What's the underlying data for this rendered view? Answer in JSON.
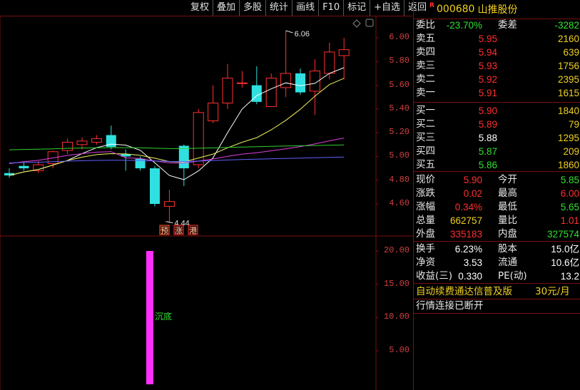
{
  "toolbar": {
    "items": [
      "复权",
      "叠加",
      "多股",
      "统计",
      "画线",
      "F10",
      "标记",
      "+自选",
      "返回"
    ]
  },
  "stock": {
    "badge": "R",
    "code": "000680",
    "name": "山推股份"
  },
  "price_axis": [
    "6.00",
    "5.80",
    "5.60",
    "5.40",
    "5.20",
    "5.00",
    "4.80",
    "4.60"
  ],
  "indicator_axis": [
    "20.00",
    "15.00",
    "10.00",
    "5.00"
  ],
  "annotations": {
    "high_mark": "6.06",
    "low_mark": "4.44",
    "tags": [
      "预",
      "涨",
      "港"
    ],
    "indicator_label": "沉底"
  },
  "colors": {
    "up": "#ff3030",
    "down": "#30e0e0",
    "ma5": "#ffffff",
    "ma10": "#f0f060",
    "ma20": "#e040e0",
    "ma30": "#30d030",
    "ma60": "#6060ff",
    "indicator_bar": "#ff30ff"
  },
  "chart_data": {
    "type": "candlestick",
    "y_range": [
      4.4,
      6.1
    ],
    "candles": [
      {
        "o": 4.86,
        "h": 4.9,
        "l": 4.82,
        "c": 4.84,
        "up": false
      },
      {
        "o": 4.92,
        "h": 4.95,
        "l": 4.88,
        "c": 4.9,
        "up": false
      },
      {
        "o": 4.88,
        "h": 4.96,
        "l": 4.86,
        "c": 4.93,
        "up": true
      },
      {
        "o": 4.94,
        "h": 5.05,
        "l": 4.9,
        "c": 5.04,
        "up": true
      },
      {
        "o": 5.05,
        "h": 5.15,
        "l": 5.02,
        "c": 5.12,
        "up": true
      },
      {
        "o": 5.1,
        "h": 5.16,
        "l": 5.06,
        "c": 5.13,
        "up": true
      },
      {
        "o": 5.12,
        "h": 5.18,
        "l": 5.1,
        "c": 5.15,
        "up": true
      },
      {
        "o": 5.18,
        "h": 5.26,
        "l": 5.06,
        "c": 5.08,
        "up": false
      },
      {
        "o": 5.02,
        "h": 5.06,
        "l": 4.88,
        "c": 5.0,
        "up": false
      },
      {
        "o": 4.98,
        "h": 5.0,
        "l": 4.88,
        "c": 4.9,
        "up": false
      },
      {
        "o": 4.9,
        "h": 4.92,
        "l": 4.58,
        "c": 4.6,
        "up": false
      },
      {
        "o": 4.58,
        "h": 4.72,
        "l": 4.44,
        "c": 4.62,
        "up": true
      },
      {
        "o": 5.09,
        "h": 5.1,
        "l": 4.75,
        "c": 4.9,
        "up": false
      },
      {
        "o": 4.93,
        "h": 5.4,
        "l": 4.9,
        "c": 5.37,
        "up": true
      },
      {
        "o": 5.3,
        "h": 5.6,
        "l": 5.28,
        "c": 5.45,
        "up": true
      },
      {
        "o": 5.45,
        "h": 5.78,
        "l": 5.4,
        "c": 5.66,
        "up": true
      },
      {
        "o": 5.62,
        "h": 5.72,
        "l": 5.58,
        "c": 5.62,
        "up": true
      },
      {
        "o": 5.6,
        "h": 5.76,
        "l": 5.44,
        "c": 5.46,
        "up": false
      },
      {
        "o": 5.42,
        "h": 5.7,
        "l": 5.42,
        "c": 5.66,
        "up": true
      },
      {
        "o": 5.58,
        "h": 6.06,
        "l": 5.5,
        "c": 5.7,
        "up": true
      },
      {
        "o": 5.7,
        "h": 5.74,
        "l": 5.52,
        "c": 5.54,
        "up": false
      },
      {
        "o": 5.55,
        "h": 5.82,
        "l": 5.35,
        "c": 5.72,
        "up": true
      },
      {
        "o": 5.7,
        "h": 5.96,
        "l": 5.65,
        "c": 5.88,
        "up": true
      },
      {
        "o": 5.85,
        "h": 6.0,
        "l": 5.65,
        "c": 5.9,
        "up": true
      }
    ],
    "indicator": {
      "bar_value": 20.0,
      "y_range": [
        0,
        21
      ]
    }
  },
  "quote": {
    "rows": [
      {
        "label": "委比",
        "value": "-23.70%",
        "label2": "委差",
        "value2": "-3282",
        "vc": "green",
        "vc2": "green"
      },
      {
        "label": "卖五",
        "value": "5.95",
        "value2": "2160",
        "vc": "red",
        "vc2": "yellow"
      },
      {
        "label": "卖四",
        "value": "5.94",
        "value2": "639",
        "vc": "red",
        "vc2": "yellow"
      },
      {
        "label": "卖三",
        "value": "5.93",
        "value2": "1756",
        "vc": "red",
        "vc2": "yellow"
      },
      {
        "label": "卖二",
        "value": "5.92",
        "value2": "2395",
        "vc": "red",
        "vc2": "yellow"
      },
      {
        "label": "卖一",
        "value": "5.91",
        "value2": "1615",
        "vc": "red",
        "vc2": "yellow"
      },
      {
        "label": "买一",
        "value": "5.90",
        "value2": "1840",
        "vc": "red",
        "vc2": "yellow"
      },
      {
        "label": "买二",
        "value": "5.89",
        "value2": "79",
        "vc": "red",
        "vc2": "yellow"
      },
      {
        "label": "买三",
        "value": "5.88",
        "value2": "1295",
        "vc": "white",
        "vc2": "yellow"
      },
      {
        "label": "买四",
        "value": "5.87",
        "value2": "209",
        "vc": "green",
        "vc2": "yellow"
      },
      {
        "label": "买五",
        "value": "5.86",
        "value2": "1860",
        "vc": "green",
        "vc2": "yellow"
      },
      {
        "label": "现价",
        "value": "5.90",
        "label2": "今开",
        "value2": "5.85",
        "vc": "red",
        "vc2": "green"
      },
      {
        "label": "涨跌",
        "value": "0.02",
        "label2": "最高",
        "value2": "6.00",
        "vc": "red",
        "vc2": "red"
      },
      {
        "label": "涨幅",
        "value": "0.34%",
        "label2": "最低",
        "value2": "5.65",
        "vc": "red",
        "vc2": "green"
      },
      {
        "label": "总量",
        "value": "662757",
        "label2": "量比",
        "value2": "1.01",
        "vc": "yellow",
        "vc2": "red"
      },
      {
        "label": "外盘",
        "value": "335183",
        "label2": "内盘",
        "value2": "327574",
        "vc": "red",
        "vc2": "green"
      },
      {
        "label": "换手",
        "value": "6.23%",
        "label2": "股本",
        "value2": "15.0亿",
        "vc": "white",
        "vc2": "white"
      },
      {
        "label": "净资",
        "value": "3.53",
        "label2": "流通",
        "value2": "10.6亿",
        "vc": "white",
        "vc2": "white"
      },
      {
        "label": "收益(三)",
        "value": "0.330",
        "label2": "PE(动)",
        "value2": "13.2",
        "vc": "white",
        "vc2": "white"
      }
    ],
    "promo": "自动续费通达信普及版",
    "promo_price": "30元/月",
    "status": "行情连接已断开"
  }
}
